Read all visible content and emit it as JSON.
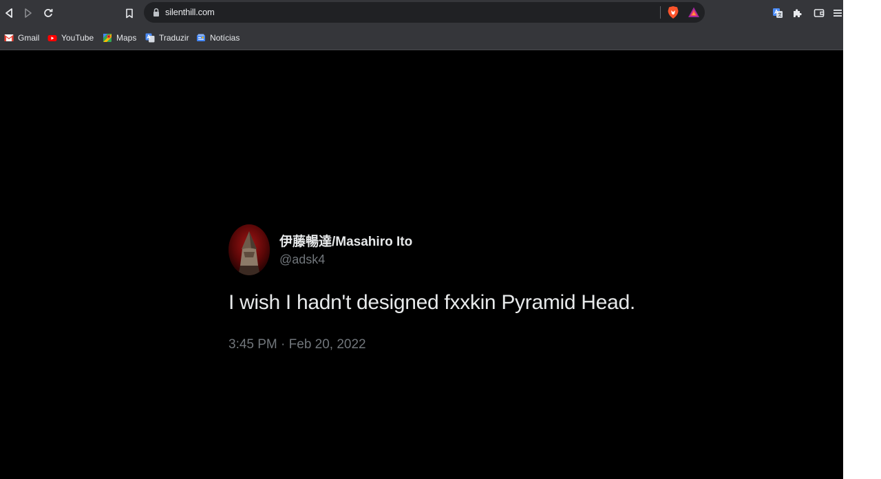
{
  "browser": {
    "url": "silenthill.com",
    "bookmarks": [
      {
        "label": "Gmail",
        "icon": "gmail-icon"
      },
      {
        "label": "YouTube",
        "icon": "youtube-icon"
      },
      {
        "label": "Maps",
        "icon": "maps-icon"
      },
      {
        "label": "Traduzir",
        "icon": "translate-icon"
      },
      {
        "label": "Notícias",
        "icon": "news-icon"
      }
    ]
  },
  "tweet": {
    "display_name": "伊藤暢達/Masahiro Ito",
    "handle": "@adsk4",
    "text": "I wish I hadn't designed fxxkin Pyramid Head.",
    "timestamp": "3:45 PM · Feb 20, 2022"
  },
  "colors": {
    "toolbar_bg": "#35363a",
    "omnibox_bg": "#202124",
    "page_bg": "#000000",
    "primary_text": "#e7e9ea",
    "secondary_text": "#71767b"
  }
}
